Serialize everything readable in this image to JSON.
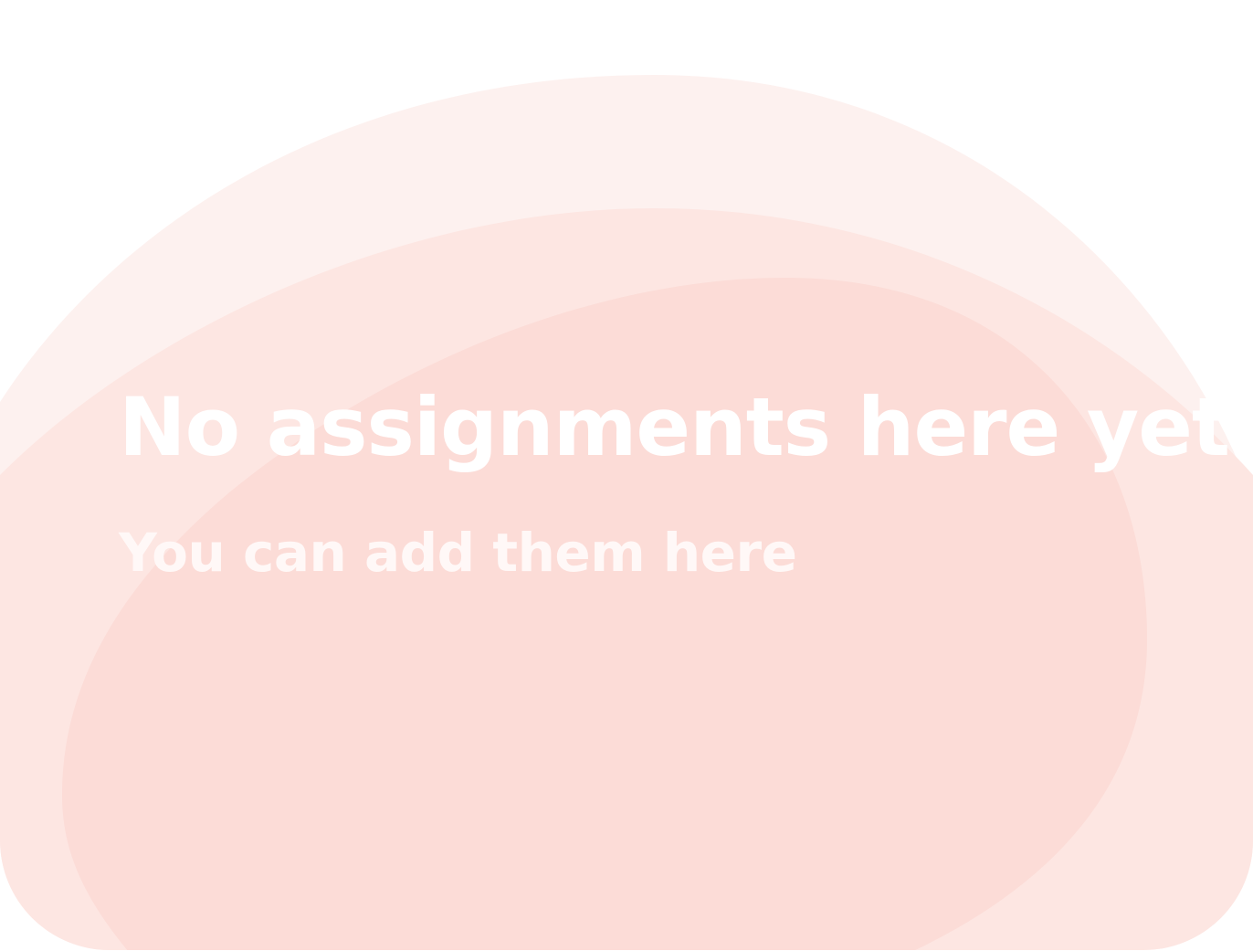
{
  "empty_state": {
    "title": "No assignments here yet",
    "subtitle": "You can add them here"
  },
  "colors": {
    "page_background": "#ffffff",
    "blob_outer": "#fdf1ef",
    "blob_middle": "#fde6e2",
    "blob_inner": "#fcdcd7",
    "title_text": "#ffffff",
    "subtitle_text": "#fff8f7"
  }
}
